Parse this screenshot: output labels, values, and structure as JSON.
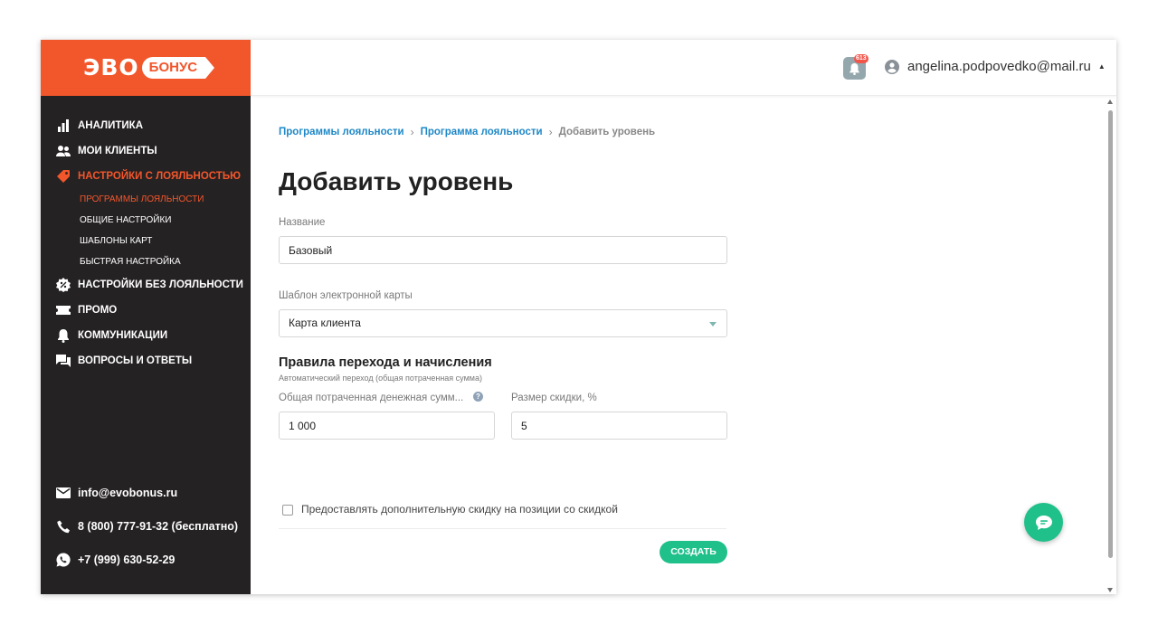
{
  "brand": {
    "logo_part1": "ЭВО",
    "logo_part2": "БОНУС",
    "accent": "#f2562b",
    "success": "#20c08b",
    "link": "#1e88c7"
  },
  "sidebar": {
    "items": [
      {
        "label": "АНАЛИТИКА",
        "icon": "bar-chart-icon"
      },
      {
        "label": "МОИ КЛИЕНТЫ",
        "icon": "people-icon"
      },
      {
        "label": "НАСТРОЙКИ С ЛОЯЛЬНОСТЬЮ",
        "icon": "tag-icon",
        "active": true
      },
      {
        "label": "НАСТРОЙКИ БЕЗ ЛОЯЛЬНОСТИ",
        "icon": "percent-badge-icon"
      },
      {
        "label": "ПРОМО",
        "icon": "ticket-icon"
      },
      {
        "label": "КОММУНИКАЦИИ",
        "icon": "bell-icon"
      },
      {
        "label": "ВОПРОСЫ И ОТВЕТЫ",
        "icon": "chat-bubbles-icon"
      }
    ],
    "subitems": [
      {
        "label": "ПРОГРАММЫ ЛОЯЛЬНОСТИ",
        "active": true
      },
      {
        "label": "ОБЩИЕ НАСТРОЙКИ"
      },
      {
        "label": "ШАБЛОНЫ КАРТ"
      },
      {
        "label": "БЫСТРАЯ НАСТРОЙКА"
      }
    ],
    "contacts": {
      "email": "info@evobonus.ru",
      "phone": "8 (800) 777-91-32 (бесплатно)",
      "whatsapp": "+7 (999) 630-52-29"
    }
  },
  "header": {
    "notifications_count": "613",
    "user_email": "angelina.podpovedko@mail.ru"
  },
  "breadcrumb": {
    "items": [
      "Программы лояльности",
      "Программа лояльности"
    ],
    "current": "Добавить уровень"
  },
  "page": {
    "title": "Добавить уровень",
    "name_label": "Название",
    "name_value": "Базовый",
    "template_label": "Шаблон электронной карты",
    "template_value": "Карта клиента",
    "rules_title": "Правила перехода и начисления",
    "rules_subtitle": "Автоматический переход (общая потраченная сумма)",
    "spent_label": "Общая потраченная денежная сумм...",
    "spent_value": "1 000",
    "discount_label": "Размер скидки, %",
    "discount_value": "5",
    "extra_discount_label": "Предоставлять дополнительную скидку на позиции со скидкой",
    "create_button": "СОЗДАТЬ"
  }
}
